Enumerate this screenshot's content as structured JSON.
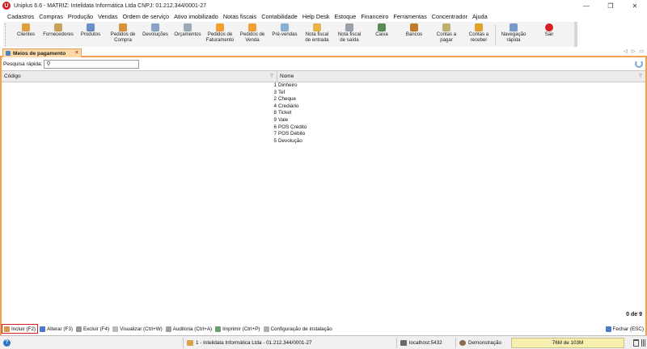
{
  "window": {
    "logo_letter": "U",
    "title": "Uniplus 6.6 - MATRIZ: Intelidata Informática Ltda CNPJ: 01.212.344/0001-27",
    "minimize": "—",
    "maximize": "❐",
    "close": "✕"
  },
  "menu": [
    "Cadastros",
    "Compras",
    "Produção",
    "Vendas",
    "Ordem de serviço",
    "Ativo imobilizado",
    "Notas fiscais",
    "Contabilidade",
    "Help Desk",
    "Estoque",
    "Financeiro",
    "Ferramentas",
    "Concentrador",
    "Ajuda"
  ],
  "toolbar": [
    {
      "name": "clientes",
      "label": "Clientes",
      "color": "#e0a13a"
    },
    {
      "name": "fornecedores",
      "label": "Fornecedores",
      "color": "#c9a25a"
    },
    {
      "name": "produtos",
      "label": "Produtos",
      "color": "#6b8fc4"
    },
    {
      "name": "pedidos-compra",
      "label": "Pedidos de\nCompra",
      "color": "#d8923a"
    },
    {
      "name": "devolucoes",
      "label": "Devoluções",
      "color": "#8aa2c8"
    },
    {
      "name": "orcamentos",
      "label": "Orçamentos",
      "color": "#9aa8b8"
    },
    {
      "name": "pedidos-faturamento",
      "label": "Pedidos de\nFaturamento",
      "color": "#f0a030"
    },
    {
      "name": "pedidos-venda",
      "label": "Pedidos de\nVenda",
      "color": "#f0a030"
    },
    {
      "name": "pre-vendas",
      "label": "Pré-vendas",
      "color": "#8ab0d8"
    },
    {
      "name": "nota-entrada",
      "label": "Nota fiscal\nde entrada",
      "color": "#e6b34a"
    },
    {
      "name": "nota-saida",
      "label": "Nota fiscal\nde saída",
      "color": "#9aa0aa"
    },
    {
      "name": "caixa",
      "label": "Caixa",
      "color": "#5a8a5a"
    },
    {
      "name": "bancos",
      "label": "Bancos",
      "color": "#c07a2a"
    },
    {
      "name": "contas-pagar",
      "label": "Contas a\npagar",
      "color": "#c0b070"
    },
    {
      "name": "contas-receber",
      "label": "Contas a\nreceber",
      "color": "#e0a030"
    },
    {
      "name": "navegacao-rapida",
      "label": "Navegação\nrápida",
      "color": "#7a9ac8"
    },
    {
      "name": "sair",
      "label": "Sair",
      "color": "#d42020"
    }
  ],
  "tab": {
    "label": "Meios de pagamento",
    "close": "×"
  },
  "tab_nav": {
    "left": "◁",
    "right": "▷",
    "menu": "▭"
  },
  "search": {
    "label": "Pesquisa rápida:",
    "glyph": "⚲",
    "value": ""
  },
  "grid": {
    "columns": {
      "codigo": "Código",
      "nome": "Nome"
    },
    "sort_glyph": "▽",
    "rows": [
      {
        "codigo": "1",
        "nome": "Dinheiro"
      },
      {
        "codigo": "3",
        "nome": "Tef"
      },
      {
        "codigo": "2",
        "nome": "Cheque"
      },
      {
        "codigo": "4",
        "nome": "Crediário"
      },
      {
        "codigo": "8",
        "nome": "Ticket"
      },
      {
        "codigo": "9",
        "nome": "Vale"
      },
      {
        "codigo": "6",
        "nome": "POS Crédito"
      },
      {
        "codigo": "7",
        "nome": "POS Débito"
      },
      {
        "codigo": "5",
        "nome": "Devolução"
      }
    ]
  },
  "record_count": "0 de 9",
  "actions": [
    {
      "name": "incluir",
      "label": "Incluir (F2)",
      "color": "#d89a4a",
      "selected": true
    },
    {
      "name": "alterar",
      "label": "Alterar (F3)",
      "color": "#4a7ac8"
    },
    {
      "name": "excluir",
      "label": "Excluir (F4)",
      "color": "#999999"
    },
    {
      "name": "visualizar",
      "label": "Visualizar (Ctrl+W)",
      "color": "#bbbbbb"
    },
    {
      "name": "auditoria",
      "label": "Auditoria (Ctrl+A)",
      "color": "#a0a0a0"
    },
    {
      "name": "imprimir",
      "label": "Imprimir (Ctrl+P)",
      "color": "#6aa06a"
    },
    {
      "name": "configuracao-instalacao",
      "label": "Configuração de instalação",
      "color": "#b0b0b0"
    }
  ],
  "close_action": {
    "label": "Fechar (ESC)"
  },
  "status": {
    "help": "?",
    "company": "1 - Intelidata Informática Ltda - 01.212.344/0001-27",
    "server": "localhost:5432",
    "user": "Demonstração",
    "memory": "76M de 103M"
  }
}
